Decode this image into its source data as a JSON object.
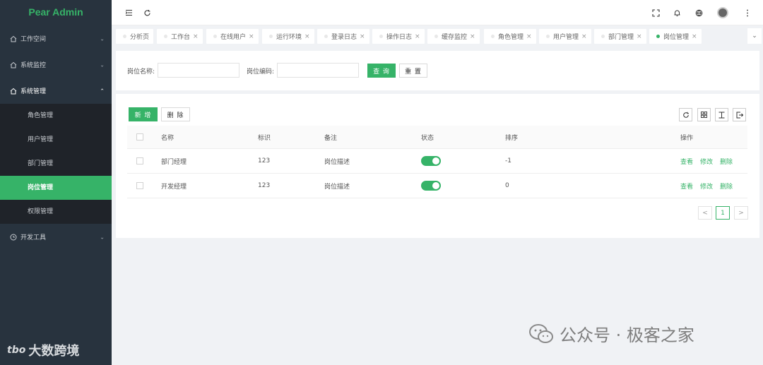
{
  "app": {
    "logo": "Pear Admin"
  },
  "sidebar": {
    "items": [
      {
        "label": "工作空间",
        "icon": "home-icon",
        "arrow": "⌄"
      },
      {
        "label": "系统监控",
        "icon": "home-icon",
        "arrow": "⌄"
      },
      {
        "label": "系统管理",
        "icon": "home-icon",
        "arrow": "⌃"
      },
      {
        "label": "开发工具",
        "icon": "clock-icon",
        "arrow": "⌄"
      }
    ],
    "submenu": [
      "角色管理",
      "用户管理",
      "部门管理",
      "岗位管理",
      "权限管理"
    ],
    "active_sub": "岗位管理",
    "bottom_brand": "大数跨境"
  },
  "tabs": [
    {
      "label": "分析页"
    },
    {
      "label": "工作台"
    },
    {
      "label": "在线用户"
    },
    {
      "label": "运行环境"
    },
    {
      "label": "登录日志"
    },
    {
      "label": "操作日志"
    },
    {
      "label": "缓存监控"
    },
    {
      "label": "角色管理"
    },
    {
      "label": "用户管理"
    },
    {
      "label": "部门管理"
    },
    {
      "label": "岗位管理",
      "active": true
    }
  ],
  "search": {
    "name_label": "岗位名称:",
    "name_value": "",
    "code_label": "岗位编码:",
    "code_value": "",
    "query_button": "查 询",
    "reset_button": "重 置"
  },
  "table": {
    "add_button": "新 增",
    "delete_button": "删 除",
    "columns": [
      "名称",
      "标识",
      "备注",
      "状态",
      "排序",
      "操作"
    ],
    "rows": [
      {
        "name": "部门经理",
        "code": "123",
        "remark": "岗位描述",
        "enabled": true,
        "sort": "-1"
      },
      {
        "name": "开发经理",
        "code": "123",
        "remark": "岗位描述",
        "enabled": true,
        "sort": "0"
      }
    ],
    "actions": [
      "查看",
      "修改",
      "删除"
    ]
  },
  "pagination": {
    "prev": "<",
    "page": "1",
    "next": ">"
  },
  "watermark": "公众号 · 极客之家",
  "colors": {
    "accent": "#36b368",
    "sidebar_bg": "#28333e"
  }
}
